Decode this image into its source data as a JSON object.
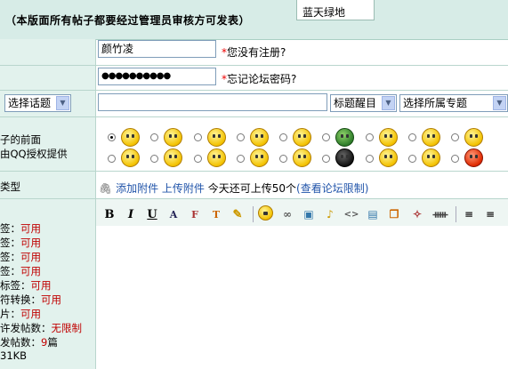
{
  "banner": {
    "text": "（本版面所有帖子都要经过管理员审核方可发表）"
  },
  "popup": {
    "text": "蓝天绿地"
  },
  "username": {
    "value": "颜竹凌",
    "hint_star": "*",
    "hint": "您没有注册?"
  },
  "password": {
    "value": "●●●●●●●●●●",
    "hint_star": "*",
    "hint": "忘记论坛密码?"
  },
  "topic": {
    "select_topic": "选择话题",
    "title_value": "",
    "title_color_select": "标题醒目",
    "special_select": "选择所属专题"
  },
  "mood": {
    "label_line1": "子的前面",
    "label_line2": "由QQ授权提供"
  },
  "attachment": {
    "left_label": "类型",
    "add": "添加附件",
    "upload": "上传附件",
    "info": "今天还可上传50个",
    "limit_link": "(查看论坛限制)"
  },
  "editor_toolbar": [
    "B",
    "I",
    "U"
  ],
  "left_status": [
    {
      "label": "签：",
      "value": "可用"
    },
    {
      "label": "签：",
      "value": "可用"
    },
    {
      "label": "签：",
      "value": "可用"
    },
    {
      "label": "签：",
      "value": "可用"
    },
    {
      "label": "标签：",
      "value": "可用"
    },
    {
      "label": "符转换：",
      "value": "可用"
    },
    {
      "label": "片：",
      "value": "可用"
    },
    {
      "label": "许发帖数：",
      "value": "无限制"
    },
    {
      "label": "发帖数：",
      "value": "9",
      "suffix": "篇"
    },
    {
      "label": "31KB",
      "value": ""
    }
  ]
}
